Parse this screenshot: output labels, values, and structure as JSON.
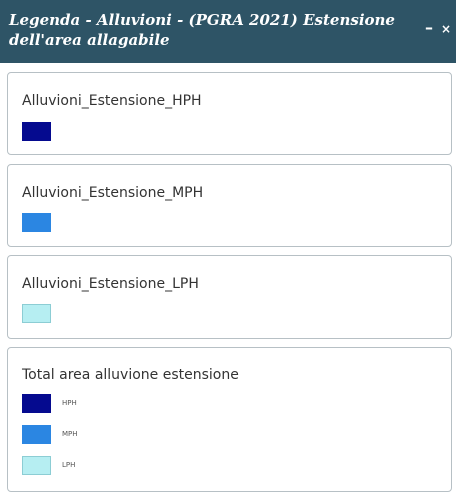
{
  "window": {
    "title": "Legenda - Alluvioni - (PGRA 2021) Estensione dell'area allagabile",
    "minimize_glyph": "–",
    "close_glyph": "×"
  },
  "colors": {
    "header_bg": "#2e5466",
    "hph": "#050a8f",
    "mph": "#2b86e2",
    "lph": "#b6eef2"
  },
  "legend": {
    "items": [
      {
        "title": "Alluvioni_Estensione_HPH",
        "color": "#050a8f"
      },
      {
        "title": "Alluvioni_Estensione_MPH",
        "color": "#2b86e2"
      },
      {
        "title": "Alluvioni_Estensione_LPH",
        "color": "#b6eef2"
      }
    ],
    "total": {
      "title": "Total area alluvione estensione",
      "entries": [
        {
          "label": "HPH",
          "color": "#050a8f"
        },
        {
          "label": "MPH",
          "color": "#2b86e2"
        },
        {
          "label": "LPH",
          "color": "#b6eef2"
        }
      ]
    }
  }
}
